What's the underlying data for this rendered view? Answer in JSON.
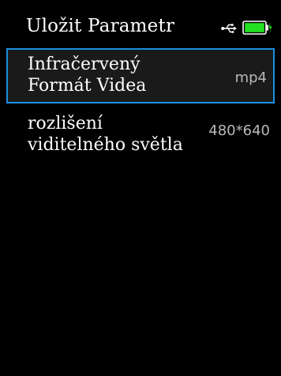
{
  "header": {
    "title": "Uložit Parametr",
    "usb_icon": "usb-icon",
    "battery_icon": "battery-charging-icon",
    "battery_color": "#22e022",
    "battery_level": 1.0
  },
  "settings": [
    {
      "label_line1": "Infračervený",
      "label_line2": "Formát Videa",
      "value": "mp4",
      "selected": true
    },
    {
      "label_line1": "rozlišení",
      "label_line2": "viditelného světla",
      "value": "480*640",
      "selected": false
    }
  ],
  "colors": {
    "background": "#000000",
    "selection_border": "#1b8fe0",
    "text": "#ffffff",
    "value_text": "#b8b8b8"
  }
}
